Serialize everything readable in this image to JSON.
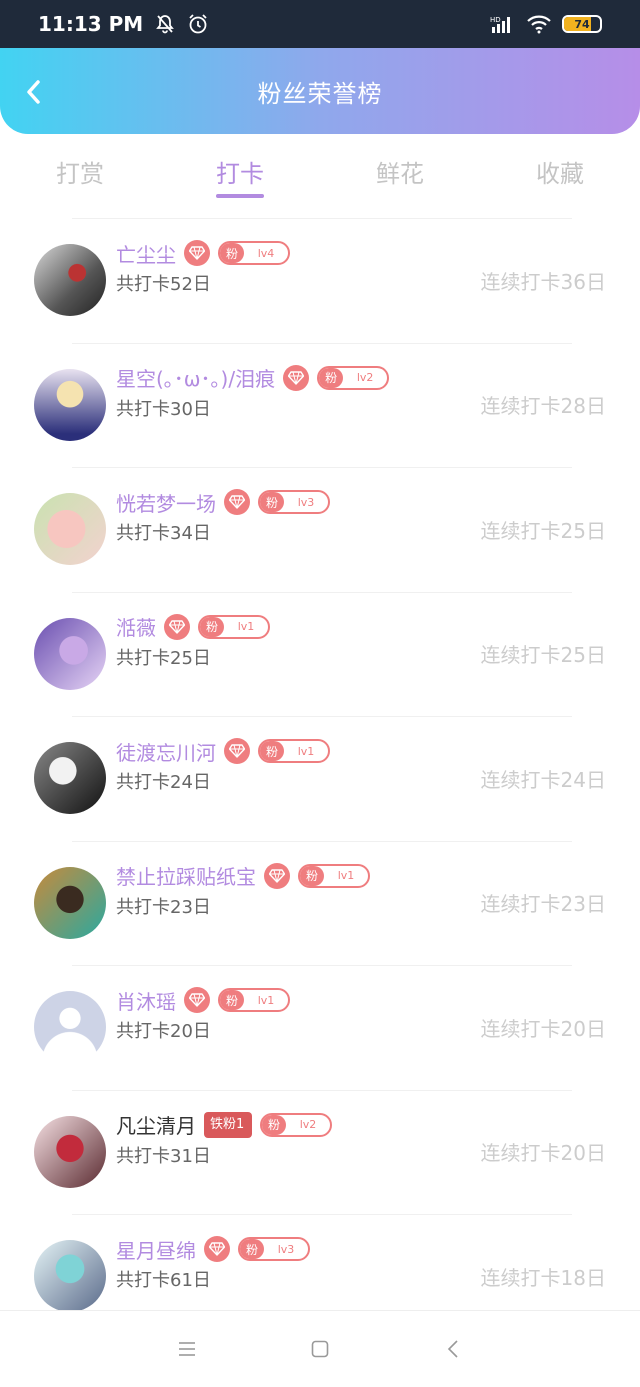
{
  "status_bar": {
    "time": "11:13 PM",
    "icons": [
      "silent-bell-icon",
      "alarm-icon",
      "signal-icon",
      "wifi-icon"
    ],
    "battery": "74",
    "battery_level": 0.74
  },
  "header": {
    "title": "粉丝荣誉榜",
    "gradient": [
      "#42d3f2",
      "#b68ee8"
    ]
  },
  "tabs": [
    {
      "label": "打赏",
      "active": false
    },
    {
      "label": "打卡",
      "active": true
    },
    {
      "label": "鲜花",
      "active": false
    },
    {
      "label": "收藏",
      "active": false
    }
  ],
  "colors": {
    "accent": "#b28be0",
    "badge": "#ef7d7f",
    "streak": "#cccccc"
  },
  "fans": [
    {
      "name": "亡尘尘",
      "fan_label": "粉",
      "level": "lv4",
      "total": "共打卡52日",
      "streak": "连续打卡36日"
    },
    {
      "name": "星空(｡･ω･｡)/泪痕",
      "fan_label": "粉",
      "level": "lv2",
      "total": "共打卡30日",
      "streak": "连续打卡28日"
    },
    {
      "name": "恍若梦一场",
      "fan_label": "粉",
      "level": "lv3",
      "total": "共打卡34日",
      "streak": "连续打卡25日"
    },
    {
      "name": "湉薇",
      "fan_label": "粉",
      "level": "lv1",
      "total": "共打卡25日",
      "streak": "连续打卡25日"
    },
    {
      "name": "徒渡忘川河",
      "fan_label": "粉",
      "level": "lv1",
      "total": "共打卡24日",
      "streak": "连续打卡24日"
    },
    {
      "name": "禁止拉踩贴纸宝",
      "fan_label": "粉",
      "level": "lv1",
      "total": "共打卡23日",
      "streak": "连续打卡23日"
    },
    {
      "name": "肖沐瑶",
      "fan_label": "粉",
      "level": "lv1",
      "total": "共打卡20日",
      "streak": "连续打卡20日"
    },
    {
      "name": "凡尘清月",
      "tag": "铁粉1",
      "fan_label": "粉",
      "level": "lv2",
      "total": "共打卡31日",
      "streak": "连续打卡20日"
    },
    {
      "name": "星月昼绵",
      "fan_label": "粉",
      "level": "lv3",
      "total": "共打卡61日",
      "streak": "连续打卡18日"
    }
  ],
  "nav_bar": {
    "icons": [
      "menu-icon",
      "home-square-icon",
      "back-chevron-icon"
    ]
  }
}
